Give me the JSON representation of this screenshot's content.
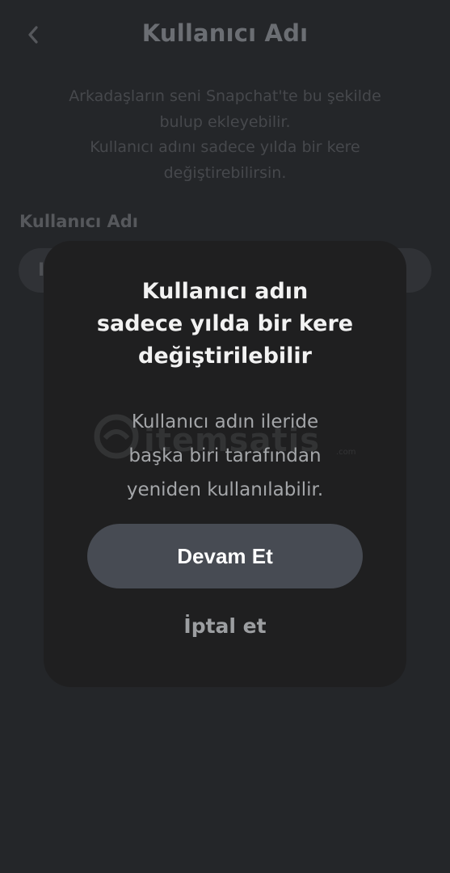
{
  "header": {
    "title": "Kullanıcı Adı",
    "back_icon": "chevron-left-icon"
  },
  "description": {
    "lines": [
      "Arkadaşların seni Snapchat'te bu şekilde",
      "bulup ekleyebilir.",
      "Kullanıcı adını sadece yılda bir kere",
      "değiştirebilirsin."
    ]
  },
  "field": {
    "label": "Kullanıcı Adı",
    "value_visible": "I"
  },
  "modal": {
    "title_lines": [
      "Kullanıcı adın",
      "sadece yılda bir kere",
      "değiştirilebilir"
    ],
    "body_lines": [
      "Kullanıcı adın ileride",
      "başka biri tarafından",
      "yeniden kullanılabilir."
    ],
    "watermark_text": "itemsatis",
    "watermark_sub": ".com",
    "primary_button": "Devam Et",
    "cancel_button": "İptal et"
  },
  "colors": {
    "background": "#242629",
    "modal": "#1f1f20",
    "primary_button": "#474b53"
  }
}
